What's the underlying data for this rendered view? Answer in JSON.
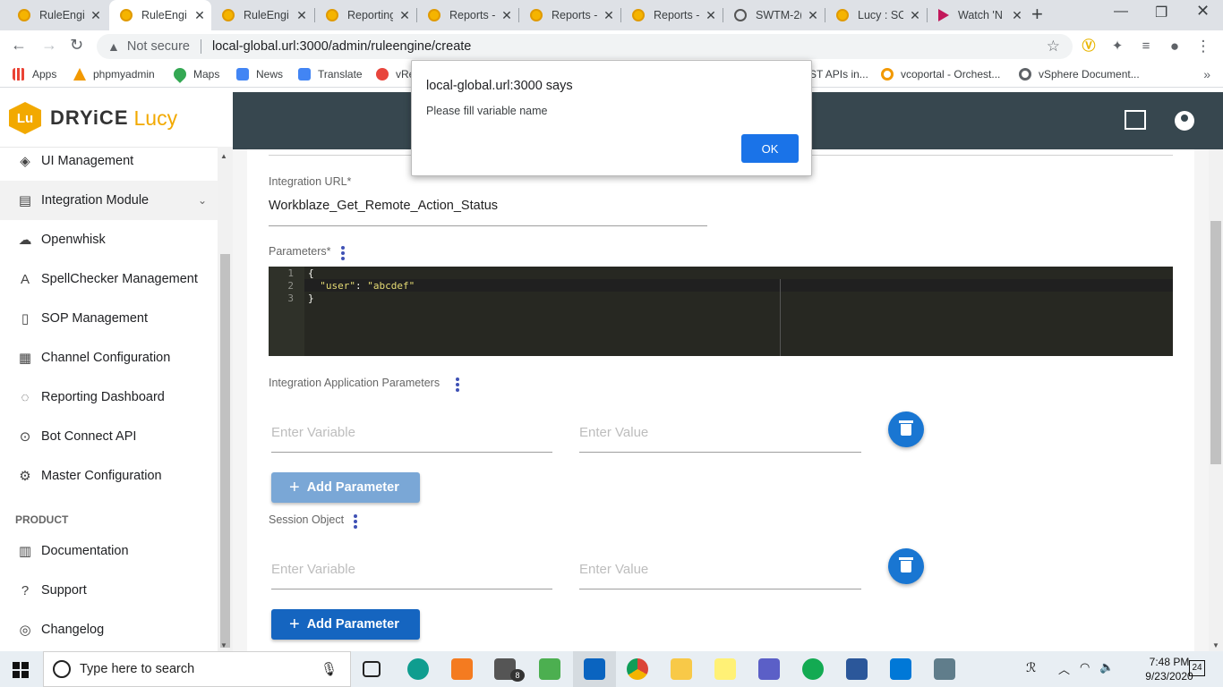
{
  "browser": {
    "tabs": [
      {
        "title": "RuleEngi",
        "icon": "lucy-icon",
        "active": false
      },
      {
        "title": "RuleEngi",
        "icon": "lucy-icon",
        "active": true
      },
      {
        "title": "RuleEngi",
        "icon": "lucy-icon",
        "active": false
      },
      {
        "title": "Reporting",
        "icon": "lucy-icon",
        "active": false
      },
      {
        "title": "Reports -",
        "icon": "lucy-icon",
        "active": false
      },
      {
        "title": "Reports -",
        "icon": "lucy-icon",
        "active": false
      },
      {
        "title": "Reports -",
        "icon": "lucy-icon",
        "active": false
      },
      {
        "title": "SWTM-2(",
        "icon": "globe-icon",
        "active": false
      },
      {
        "title": "Lucy : SO",
        "icon": "lucy-icon",
        "active": false
      },
      {
        "title": "Watch 'N",
        "icon": "play-icon",
        "active": false
      }
    ],
    "security_label": "Not secure",
    "url": "local-global.url:3000/admin/ruleengine/create",
    "bookmarks": [
      {
        "label": "Apps",
        "icon": "apps-grid-icon",
        "color": "#ea4335"
      },
      {
        "label": "phpmyadmin",
        "icon": "pma-icon",
        "color": "#f29900"
      },
      {
        "label": "Maps",
        "icon": "maps-pin-icon",
        "color": "#34a853"
      },
      {
        "label": "News",
        "icon": "news-icon",
        "color": "#4285f4"
      },
      {
        "label": "Translate",
        "icon": "translate-icon",
        "color": "#4285f4"
      },
      {
        "label": "vRe",
        "icon": "vre-icon",
        "color": "#e8453c"
      },
      {
        "label": "ST APIs in...",
        "icon": "",
        "color": ""
      },
      {
        "label": "vcoportal - Orchest...",
        "icon": "vco-icon",
        "color": "#f29900"
      },
      {
        "label": "vSphere Document...",
        "icon": "vsphere-icon",
        "color": "#5f6368"
      }
    ]
  },
  "app": {
    "brand": "DRYiCE",
    "product": "Lucy",
    "logo_mark": "Lu",
    "accent_color": "#f2a900",
    "topbar_color": "#37474f",
    "sidebar": {
      "items": [
        {
          "label": "UI Management",
          "icon": "paint-bucket-icon"
        },
        {
          "label": "Integration Module",
          "icon": "integration-icon",
          "selected": true
        },
        {
          "label": "Openwhisk",
          "icon": "cloud-icon"
        },
        {
          "label": "SpellChecker Management",
          "icon": "spellcheck-icon"
        },
        {
          "label": "SOP Management",
          "icon": "clipboard-icon"
        },
        {
          "label": "Channel Configuration",
          "icon": "dashboard-icon"
        },
        {
          "label": "Reporting Dashboard",
          "icon": "palette-icon"
        },
        {
          "label": "Bot Connect API",
          "icon": "dots-circle-icon"
        },
        {
          "label": "Master Configuration",
          "icon": "gear-icon"
        }
      ],
      "section_label": "PRODUCT",
      "product_items": [
        {
          "label": "Documentation",
          "icon": "book-icon"
        },
        {
          "label": "Support",
          "icon": "help-icon"
        },
        {
          "label": "Changelog",
          "icon": "history-icon"
        }
      ]
    },
    "form": {
      "integration_url_label": "Integration URL*",
      "integration_url_value": "Workblaze_Get_Remote_Action_Status",
      "parameters_label": "Parameters*",
      "code_lines": [
        "{",
        "  \"user\": \"abcdef\"",
        "}"
      ],
      "code_key": "\"user\"",
      "code_value": "\"abcdef\"",
      "line_numbers": [
        "1",
        "2",
        "3"
      ],
      "integration_params_label": "Integration Application Parameters",
      "session_object_label": "Session Object",
      "variable_placeholder": "Enter Variable",
      "value_placeholder": "Enter Value",
      "add_parameter_label": "Add Parameter"
    }
  },
  "dialog": {
    "title": "local-global.url:3000 says",
    "message": "Please fill variable name",
    "ok_label": "OK"
  },
  "taskbar": {
    "search_placeholder": "Type here to search",
    "time": "7:48 PM",
    "date": "9/23/2020",
    "notification_count": "24",
    "mail_badge": "8"
  }
}
